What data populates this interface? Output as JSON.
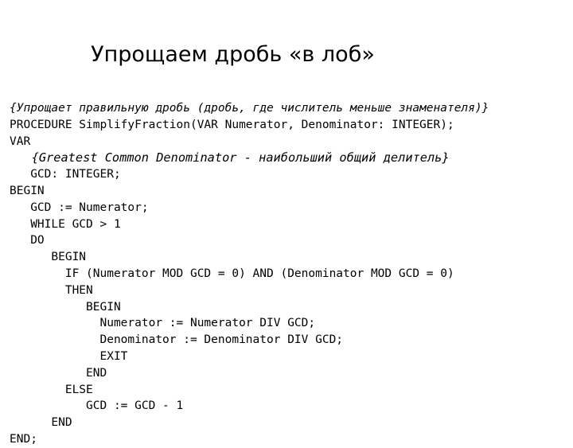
{
  "slide": {
    "title": "Упрощаем дробь «в лоб»",
    "background_color": "#ffffff",
    "text_color": "#000000",
    "code": {
      "language": "Pascal",
      "lines": [
        {
          "text": "{Упрощает правильную дробь (дробь, где числитель меньше знаменателя)}",
          "style": "comment"
        },
        {
          "text": "PROCEDURE SimplifyFraction(VAR Numerator, Denominator: INTEGER);",
          "style": "code"
        },
        {
          "text": "VAR",
          "style": "code"
        },
        {
          "text": "   {Greatest Common Denominator - наибольший общий делитель}",
          "style": "comment-inner"
        },
        {
          "text": "   GCD: INTEGER;",
          "style": "code"
        },
        {
          "text": "BEGIN",
          "style": "code"
        },
        {
          "text": "   GCD := Numerator;",
          "style": "code"
        },
        {
          "text": "   WHILE GCD > 1",
          "style": "code"
        },
        {
          "text": "   DO",
          "style": "code"
        },
        {
          "text": "      BEGIN",
          "style": "code"
        },
        {
          "text": "        IF (Numerator MOD GCD = 0) AND (Denominator MOD GCD = 0)",
          "style": "code"
        },
        {
          "text": "        THEN",
          "style": "code"
        },
        {
          "text": "           BEGIN",
          "style": "code"
        },
        {
          "text": "             Numerator := Numerator DIV GCD;",
          "style": "code"
        },
        {
          "text": "             Denominator := Denominator DIV GCD;",
          "style": "code"
        },
        {
          "text": "             EXIT",
          "style": "code"
        },
        {
          "text": "           END",
          "style": "code"
        },
        {
          "text": "        ELSE",
          "style": "code"
        },
        {
          "text": "           GCD := GCD - 1",
          "style": "code"
        },
        {
          "text": "      END",
          "style": "code"
        },
        {
          "text": "END;",
          "style": "code"
        }
      ]
    }
  }
}
